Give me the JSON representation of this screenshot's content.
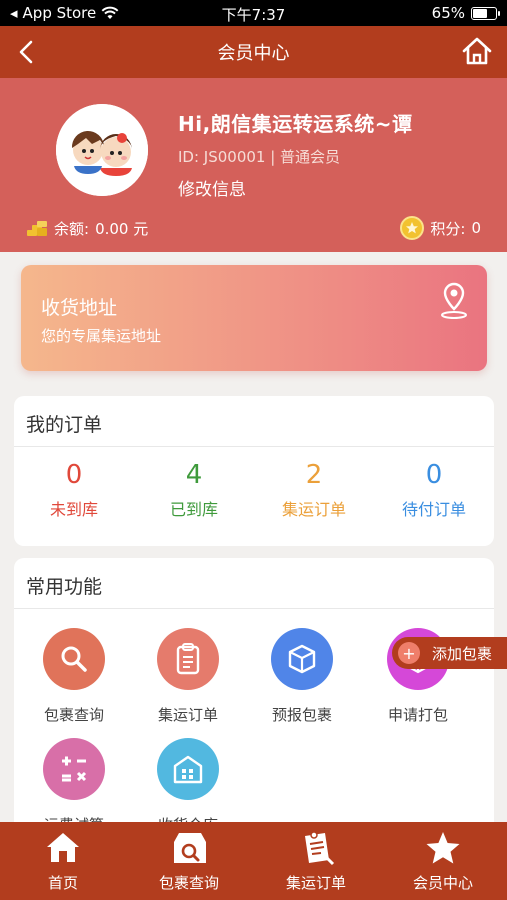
{
  "status_bar": {
    "carrier": "App Store",
    "time": "下午7:37",
    "battery": "65%",
    "battery_level": 0.65
  },
  "nav": {
    "title": "会员中心"
  },
  "profile": {
    "name": "Hi,朗信集运转运系统~谭",
    "id_line": "ID: JS00001 | 普通会员",
    "edit_label": "修改信息",
    "balance_label": "余额:",
    "balance_value": "0.00 元",
    "points_label": "积分:",
    "points_value": "0"
  },
  "address": {
    "title": "收货地址",
    "subtitle": "您的专属集运地址"
  },
  "orders": {
    "title": "我的订单",
    "stats": [
      {
        "value": "0",
        "label": "未到库",
        "color": "#e0483a"
      },
      {
        "value": "4",
        "label": "已到库",
        "color": "#3f9a3c"
      },
      {
        "value": "2",
        "label": "集运订单",
        "color": "#eba03a"
      },
      {
        "value": "0",
        "label": "待付订单",
        "color": "#3a8ee0"
      }
    ]
  },
  "functions": {
    "title": "常用功能",
    "items": [
      {
        "label": "包裹查询",
        "icon": "search-icon",
        "color": "#e0735a"
      },
      {
        "label": "集运订单",
        "icon": "clipboard-icon",
        "color": "#e57b6c"
      },
      {
        "label": "预报包裹",
        "icon": "box-icon",
        "color": "#5085e8"
      },
      {
        "label": "申请打包",
        "icon": "package-icon",
        "color": "#d548d8"
      },
      {
        "label": "运费试算",
        "icon": "calculator-icon",
        "color": "#d86fa8"
      },
      {
        "label": "收货仓库",
        "icon": "warehouse-icon",
        "color": "#52b8e0"
      }
    ]
  },
  "add_parcel": {
    "label": "添加包裹"
  },
  "tabs": [
    {
      "label": "首页",
      "icon": "home-icon"
    },
    {
      "label": "包裹查询",
      "icon": "parcel-search-icon"
    },
    {
      "label": "集运订单",
      "icon": "order-icon"
    },
    {
      "label": "会员中心",
      "icon": "star-icon"
    }
  ]
}
